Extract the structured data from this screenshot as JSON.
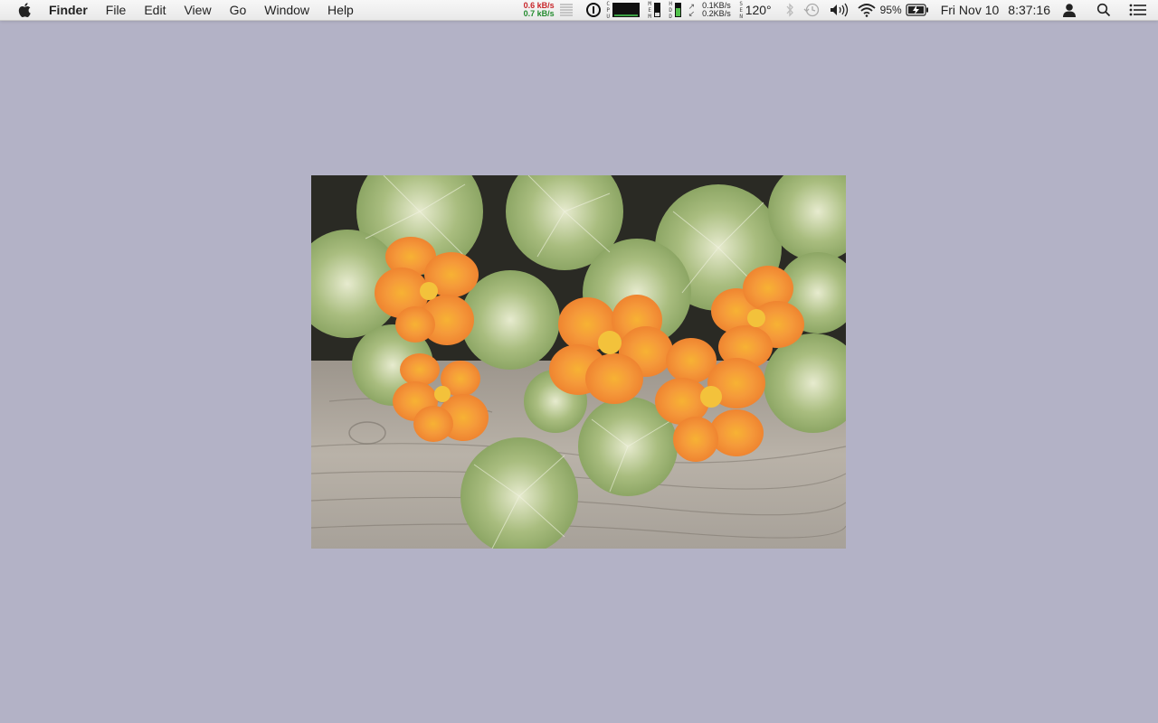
{
  "menubar": {
    "app_name": "Finder",
    "menus": [
      "File",
      "Edit",
      "View",
      "Go",
      "Window",
      "Help"
    ],
    "network_up": "0.6 kB/s",
    "network_down": "0.7 kB/s",
    "cpu_label": "CPU",
    "mem_label": "MEM",
    "hdd_label": "HDD",
    "net_up": "0.1KB/s",
    "net_down": "0.2KB/s",
    "sensor_label": "SEN",
    "temperature": "120°",
    "battery_percent": "95%",
    "date": "Fri Nov 10",
    "time": "8:37:16"
  },
  "desktop": {
    "background_color": "#b3b2c6",
    "picture": "nasturtium-flowers-photo"
  },
  "colors": {
    "upload": "#c8262a",
    "download": "#238b2e",
    "hdd_fill": "#52c24b"
  }
}
